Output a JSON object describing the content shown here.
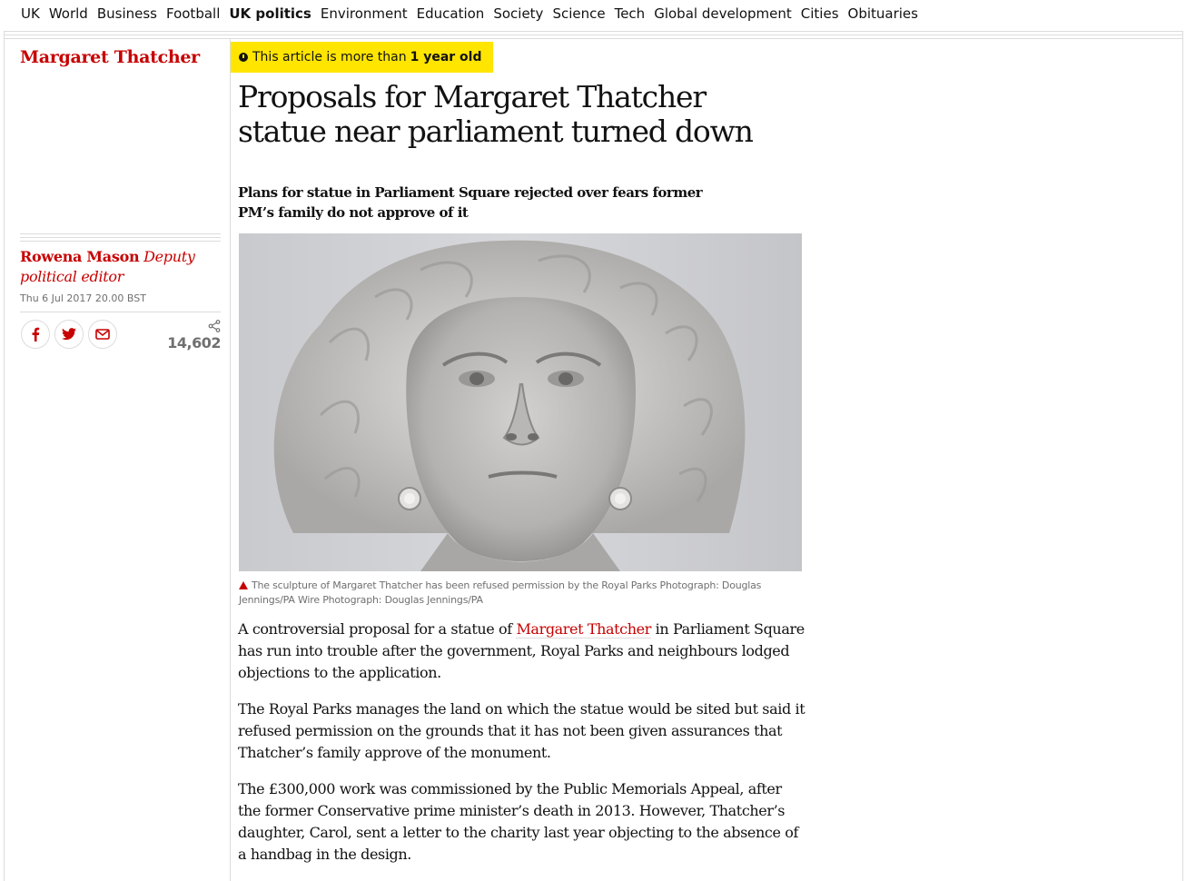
{
  "nav": {
    "items": [
      {
        "label": "UK",
        "active": false
      },
      {
        "label": "World",
        "active": false
      },
      {
        "label": "Business",
        "active": false
      },
      {
        "label": "Football",
        "active": false
      },
      {
        "label": "UK politics",
        "active": true
      },
      {
        "label": "Environment",
        "active": false
      },
      {
        "label": "Education",
        "active": false
      },
      {
        "label": "Society",
        "active": false
      },
      {
        "label": "Science",
        "active": false
      },
      {
        "label": "Tech",
        "active": false
      },
      {
        "label": "Global development",
        "active": false
      },
      {
        "label": "Cities",
        "active": false
      },
      {
        "label": "Obituaries",
        "active": false
      }
    ]
  },
  "article": {
    "series": "Margaret Thatcher",
    "age_notice_prefix": "This article is more than",
    "age_notice_bold": "1 year old",
    "headline": "Proposals for Margaret Thatcher statue near parliament turned down",
    "standfirst": "Plans for statue in Parliament Square rejected over fears former PM’s family do not approve of it",
    "byline_name": "Rowena Mason",
    "byline_role": "Deputy political editor",
    "dateline": "Thu 6 Jul 2017 20.00 BST",
    "share_count": "14,602",
    "caption": "The sculpture of Margaret Thatcher has been refused permission by the Royal Parks Photograph: Douglas Jennings/PA Wire Photograph: Douglas Jennings/PA",
    "body": {
      "p1_before": "A controversial proposal for a statue of ",
      "p1_link": "Margaret Thatcher",
      "p1_after": " in Parliament Square has run into trouble after the government, Royal Parks and neighbours lodged objections to the application.",
      "p2": "The Royal Parks manages the land on which the statue would be sited but said it refused permission on the grounds that it has not been given assurances that Thatcher’s family approve of the monument.",
      "p3": "The £300,000 work was commissioned by the Public Memorials Appeal, after the former Conservative prime minister’s death in 2013. However, Thatcher’s daughter, Carol, sent a letter to the charity last year objecting to the absence of a handbag in the design."
    }
  },
  "colors": {
    "accent_red": "#c70000",
    "badge_yellow": "#ffe500",
    "rule_gray": "#dcdcdc",
    "meta_gray": "#707070"
  },
  "icons": {
    "share_facebook": "facebook-icon",
    "share_twitter": "twitter-icon",
    "share_email": "email-icon",
    "share_count": "share-icon",
    "age_notice": "clock-icon",
    "caption": "triangle-icon"
  }
}
